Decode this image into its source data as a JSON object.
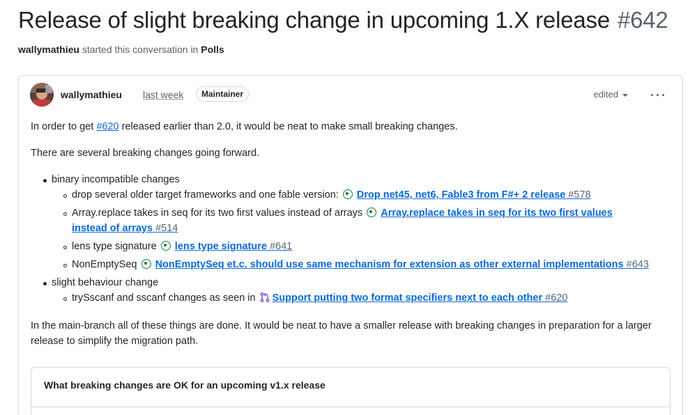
{
  "discussion": {
    "title": "Release of slight breaking change in upcoming 1.X release",
    "number": "#642",
    "author": "wallymathieu",
    "started_text": "started this conversation in",
    "category": "Polls"
  },
  "comment": {
    "author": "wallymathieu",
    "time": "last week",
    "badge": "Maintainer",
    "edited_label": "edited",
    "para1": {
      "before": "In order to get ",
      "link": "#620",
      "after": " released earlier than 2.0, it would be neat to make small breaking changes."
    },
    "para2": "There are several breaking changes going forward.",
    "list": [
      {
        "label": "binary incompatible changes",
        "items": [
          {
            "text": "drop several older target frameworks and one fable version:",
            "link": "Drop net45, net6, Fable3 from F#+ 2 release",
            "ref": "#578",
            "icon": "issue-open-icon"
          },
          {
            "text": "Array.replace takes in seq for its two first values instead of arrays",
            "link_line1": "Array.replace takes in seq for its two first values",
            "link_line2": "instead of arrays",
            "ref": "#514",
            "icon": "issue-open-icon"
          },
          {
            "text": "lens type signature",
            "link": "lens type signature",
            "ref": "#641",
            "icon": "issue-open-icon"
          },
          {
            "text": "NonEmptySeq",
            "link": "NonEmptySeq et.c. should use same mechanism for extension as other external implementations",
            "ref": "#643",
            "icon": "issue-open-icon"
          }
        ]
      },
      {
        "label": "slight behaviour change",
        "items": [
          {
            "text": "trySscanf and sscanf changes as seen in",
            "link": "Support putting two format specifiers next to each other",
            "ref": "#620",
            "icon": "pull-request-icon"
          }
        ]
      }
    ],
    "para3": "In the main-branch all of these things are done. It would be neat to have a smaller release with breaking changes in preparation for a larger release to simplify the migration path."
  },
  "poll": {
    "question": "What breaking changes are OK for an upcoming v1.x release"
  },
  "colors": {
    "link": "#0969da",
    "issue_open": "#1a7f37",
    "pr": "#8250df",
    "muted": "#59636e",
    "border": "#d1d9e0"
  }
}
